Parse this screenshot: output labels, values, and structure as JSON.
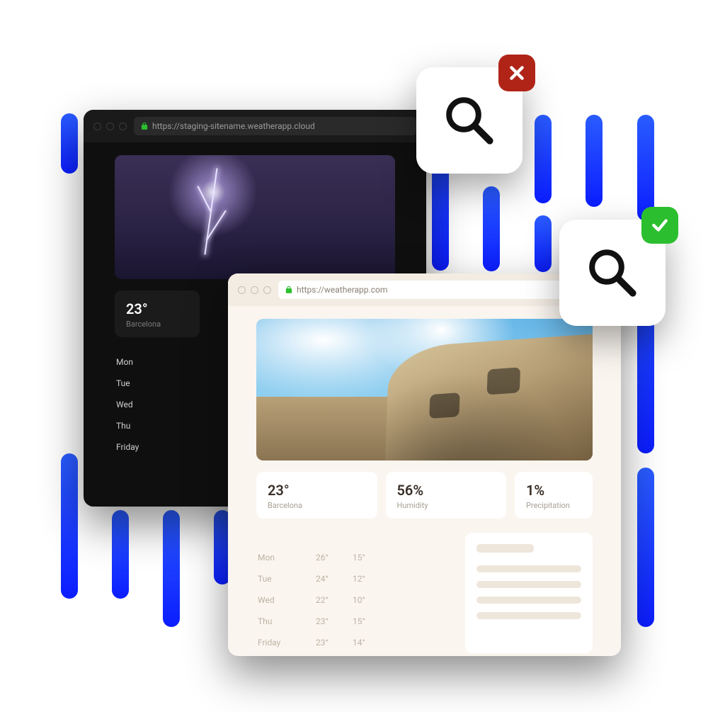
{
  "colors": {
    "bar_gradient_from": "#2a5cff",
    "bar_gradient_to": "#0b1dff",
    "fail": "#b02418",
    "ok": "#2bbf2f"
  },
  "dark_window": {
    "url": "https://staging-sitename.weatherapp.cloud",
    "stat": {
      "value": "23°",
      "label": "Barcelona"
    },
    "days": [
      "Mon",
      "Tue",
      "Wed",
      "Thu",
      "Friday"
    ]
  },
  "light_window": {
    "url": "https://weatherapp.com",
    "stats": [
      {
        "value": "23°",
        "label": "Barcelona"
      },
      {
        "value": "56%",
        "label": "Humidity"
      },
      {
        "value": "1%",
        "label": "Precipitation"
      }
    ],
    "forecast": [
      {
        "day": "Mon",
        "hi": "26°",
        "lo": "15°"
      },
      {
        "day": "Tue",
        "hi": "24°",
        "lo": "12°"
      },
      {
        "day": "Wed",
        "hi": "22°",
        "lo": "10°"
      },
      {
        "day": "Thu",
        "hi": "23°",
        "lo": "15°"
      },
      {
        "day": "Friday",
        "hi": "23°",
        "lo": "14°"
      }
    ]
  },
  "badges": {
    "top": {
      "icon": "search-icon",
      "status": "fail"
    },
    "bottom": {
      "icon": "search-icon",
      "status": "ok"
    }
  }
}
